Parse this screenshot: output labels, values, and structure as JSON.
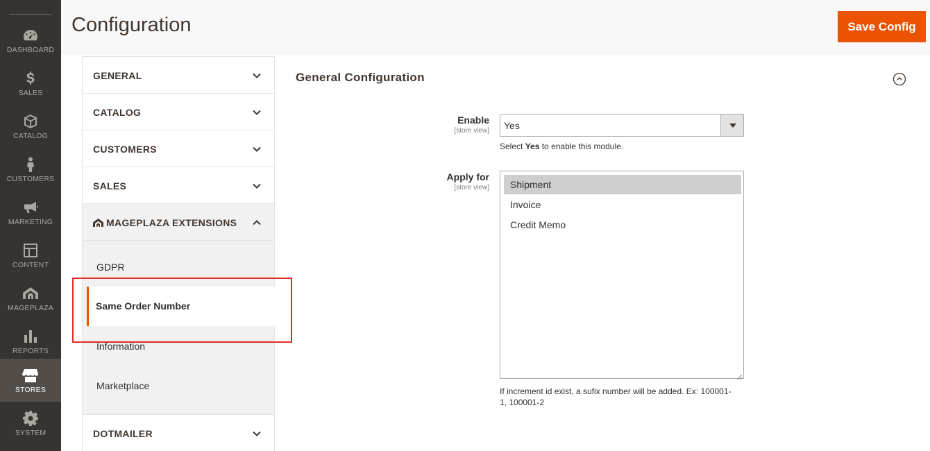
{
  "nav": {
    "items": [
      {
        "label": "DASHBOARD",
        "icon": "dashboard-icon"
      },
      {
        "label": "SALES",
        "icon": "dollar-icon"
      },
      {
        "label": "CATALOG",
        "icon": "box-icon"
      },
      {
        "label": "CUSTOMERS",
        "icon": "person-icon"
      },
      {
        "label": "MARKETING",
        "icon": "megaphone-icon"
      },
      {
        "label": "CONTENT",
        "icon": "layout-icon"
      },
      {
        "label": "MAGEPLAZA",
        "icon": "mageplaza-icon"
      },
      {
        "label": "REPORTS",
        "icon": "bar-chart-icon"
      },
      {
        "label": "STORES",
        "icon": "store-icon"
      },
      {
        "label": "SYSTEM",
        "icon": "gear-icon"
      }
    ],
    "active": "STORES"
  },
  "header": {
    "title": "Configuration",
    "save_label": "Save Config"
  },
  "tabs": {
    "groups": [
      {
        "label": "GENERAL"
      },
      {
        "label": "CATALOG"
      },
      {
        "label": "CUSTOMERS"
      },
      {
        "label": "SALES"
      },
      {
        "label": "MAGEPLAZA EXTENSIONS"
      },
      {
        "label": "DOTMAILER"
      }
    ],
    "mageplaza_items": [
      {
        "label": "GDPR"
      },
      {
        "label": "Same Order Number"
      },
      {
        "label": "Information"
      },
      {
        "label": "Marketplace"
      }
    ],
    "active_item": "Same Order Number"
  },
  "section": {
    "title": "General Configuration",
    "enable": {
      "label": "Enable",
      "scope": "[store view]",
      "value": "Yes",
      "note_prefix": "Select ",
      "note_bold": "Yes",
      "note_suffix": " to enable this module."
    },
    "apply_for": {
      "label": "Apply for",
      "scope": "[store view]",
      "options": [
        "Shipment",
        "Invoice",
        "Credit Memo"
      ],
      "selected": "Shipment",
      "note_line1": "If increment id exist, a sufix number will be added. Ex: 100001-",
      "note_line2": "1, 100001-2"
    }
  },
  "colors": {
    "accent": "#eb5202",
    "nav_bg": "#373330",
    "highlight_box": "#e02b27"
  }
}
